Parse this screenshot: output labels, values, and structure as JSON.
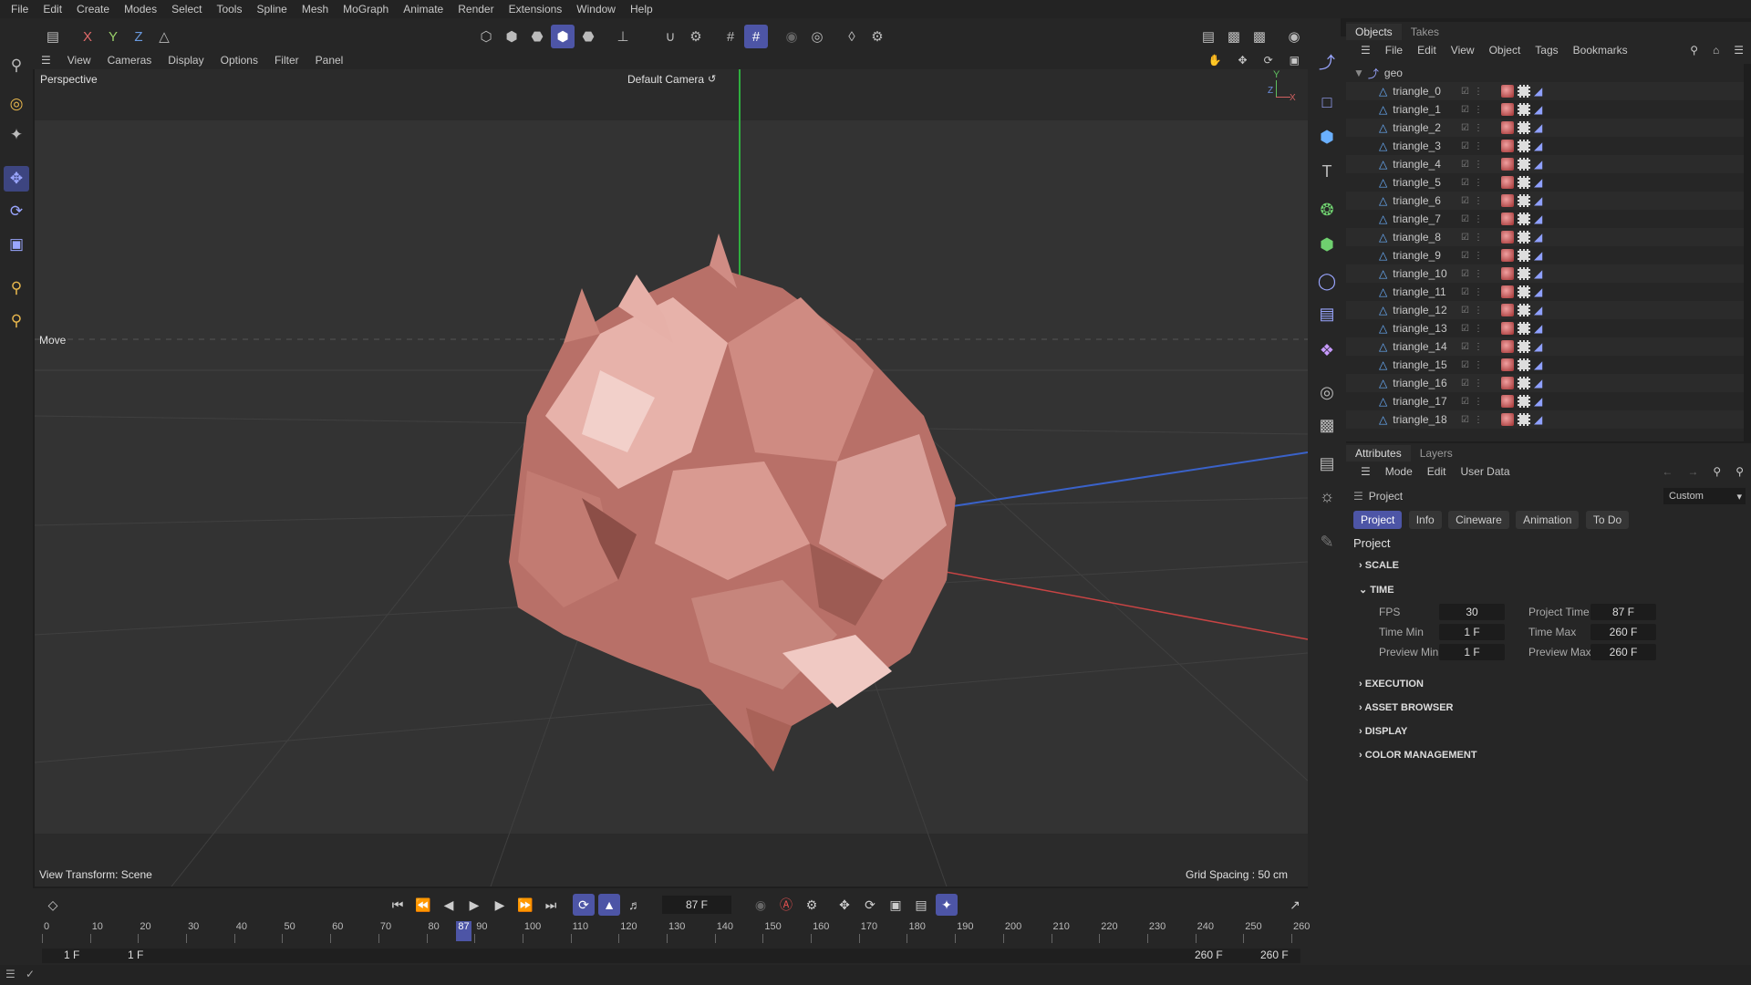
{
  "menubar": {
    "items": [
      "File",
      "Edit",
      "Create",
      "Modes",
      "Select",
      "Tools",
      "Spline",
      "Mesh",
      "MoGraph",
      "Animate",
      "Render",
      "Extensions",
      "Window",
      "Help"
    ]
  },
  "toolbar": {
    "axes": [
      "X",
      "Y",
      "Z"
    ]
  },
  "viewport": {
    "menu": [
      "View",
      "Cameras",
      "Display",
      "Options",
      "Filter",
      "Panel"
    ],
    "view_name": "Perspective",
    "camera": "Default Camera",
    "tool_hint": "Move",
    "view_transform": "View Transform: Scene",
    "grid_spacing": "Grid Spacing : 50 cm",
    "axis_y": "Y",
    "axis_x": "X",
    "axis_z": "Z"
  },
  "objects_panel": {
    "tabs": [
      "Objects",
      "Takes"
    ],
    "menu": [
      "File",
      "Edit",
      "View",
      "Object",
      "Tags",
      "Bookmarks"
    ],
    "root": "geo",
    "children": [
      "triangle_0",
      "triangle_1",
      "triangle_2",
      "triangle_3",
      "triangle_4",
      "triangle_5",
      "triangle_6",
      "triangle_7",
      "triangle_8",
      "triangle_9",
      "triangle_10",
      "triangle_11",
      "triangle_12",
      "triangle_13",
      "triangle_14",
      "triangle_15",
      "triangle_16",
      "triangle_17",
      "triangle_18"
    ]
  },
  "attributes_panel": {
    "tabs": [
      "Attributes",
      "Layers"
    ],
    "menu": [
      "Mode",
      "Edit",
      "User Data"
    ],
    "context": "Project",
    "preset": "Custom",
    "subtabs": [
      "Project",
      "Info",
      "Cineware",
      "Animation",
      "To Do"
    ],
    "title": "Project",
    "sections": {
      "scale": "SCALE",
      "time": "TIME",
      "execution": "EXECUTION",
      "asset_browser": "ASSET BROWSER",
      "display": "DISPLAY",
      "color_management": "COLOR MANAGEMENT"
    },
    "time": {
      "fps_label": "FPS",
      "fps": "30",
      "project_time_label": "Project Time",
      "project_time": "87 F",
      "time_min_label": "Time Min",
      "time_min": "1 F",
      "time_max_label": "Time Max",
      "time_max": "260 F",
      "preview_min_label": "Preview Min",
      "preview_min": "1 F",
      "preview_max_label": "Preview Max",
      "preview_max": "260 F"
    }
  },
  "timeline": {
    "current_frame": "87 F",
    "ticks": [
      "0",
      "10",
      "20",
      "30",
      "40",
      "50",
      "60",
      "70",
      "80",
      "90",
      "100",
      "110",
      "120",
      "130",
      "140",
      "150",
      "160",
      "170",
      "180",
      "190",
      "200",
      "210",
      "220",
      "230",
      "240",
      "250",
      "260"
    ],
    "playhead_label": "87",
    "range_start": "1 F",
    "preview_start": "1 F",
    "preview_end": "260 F",
    "range_end": "260 F"
  },
  "colors": {
    "accent": "#4d55a6",
    "panel": "#262626",
    "viewport": "#333333",
    "mesh": "#c98379"
  }
}
